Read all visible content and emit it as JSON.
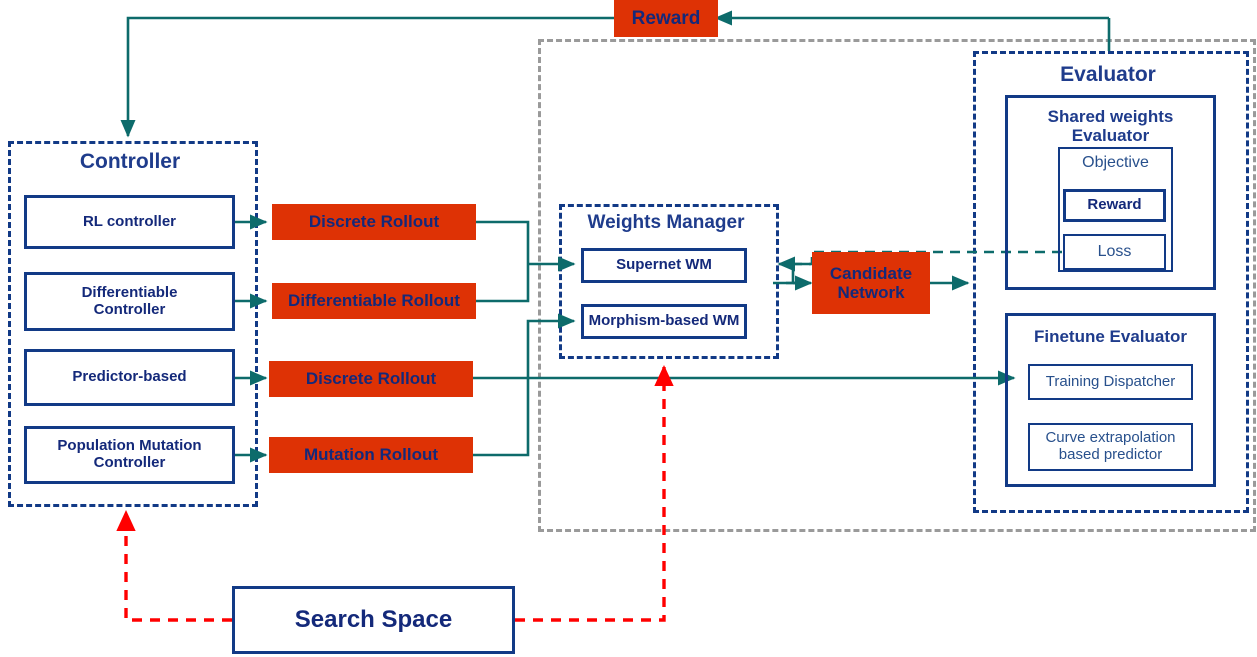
{
  "diagram": {
    "title": "NAS framework architecture",
    "colors": {
      "navy": "#123A86",
      "navy_text": "#14297A",
      "orange": "#DE3205",
      "teal": "#0D6B6B",
      "red": "#FF0000",
      "gray": "#9A9A9A"
    }
  },
  "reward": {
    "label": "Reward"
  },
  "controller": {
    "title": "Controller",
    "items": [
      {
        "label": "RL controller"
      },
      {
        "label": "Differentiable\nController",
        "line1": "Differentiable",
        "line2": "Controller"
      },
      {
        "label": "Predictor-based"
      },
      {
        "label": "Population Mutation\nController",
        "line1": "Population Mutation",
        "line2": "Controller"
      }
    ]
  },
  "rollouts": [
    {
      "label": "Discrete Rollout"
    },
    {
      "label": "Differentiable Rollout"
    },
    {
      "label": "Discrete Rollout"
    },
    {
      "label": "Mutation Rollout"
    }
  ],
  "weights_manager": {
    "title": "Weights  Manager",
    "items": [
      {
        "label": "Supernet WM"
      },
      {
        "label": "Morphism-based WM"
      }
    ]
  },
  "candidate_network": {
    "line1": "Candidate",
    "line2": "Network"
  },
  "evaluator": {
    "title": "Evaluator",
    "shared_weights": {
      "title_line1": "Shared weights",
      "title_line2": "Evaluator",
      "objective": {
        "label": "Objective",
        "items": [
          {
            "label": "Reward"
          },
          {
            "label": "Loss"
          }
        ]
      }
    },
    "finetune": {
      "title": "Finetune Evaluator",
      "items": [
        {
          "label": "Training Dispatcher"
        },
        {
          "line1": "Curve extrapolation",
          "line2": "based predictor"
        }
      ]
    }
  },
  "search_space": {
    "label": "Search Space"
  }
}
